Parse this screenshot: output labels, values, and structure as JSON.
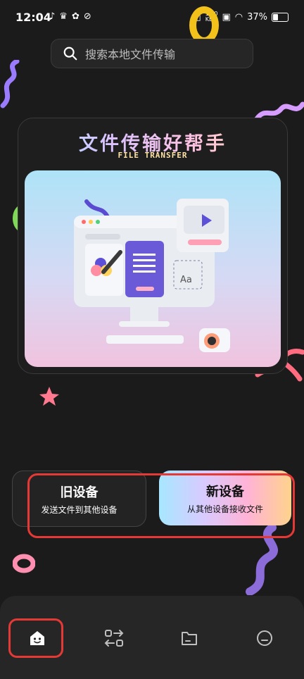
{
  "status": {
    "time": "12:04",
    "net_speed_value": "1.20",
    "net_speed_unit": "KB/s",
    "battery": "37%"
  },
  "search": {
    "placeholder": "搜索本地文件传输"
  },
  "hero": {
    "title": "文件传输好帮手",
    "subtitle": "FILE TRANSFER",
    "illus_text": "Aa"
  },
  "actions": {
    "old_device": {
      "title": "旧设备",
      "subtitle": "发送文件到其他设备"
    },
    "new_device": {
      "title": "新设备",
      "subtitle": "从其他设备接收文件"
    }
  },
  "nav": {
    "items": [
      "home-icon",
      "transfer-icon",
      "folder-icon",
      "profile-icon"
    ],
    "active_index": 0
  },
  "colors": {
    "highlight": "#e53935",
    "background": "#1b1b1b"
  }
}
